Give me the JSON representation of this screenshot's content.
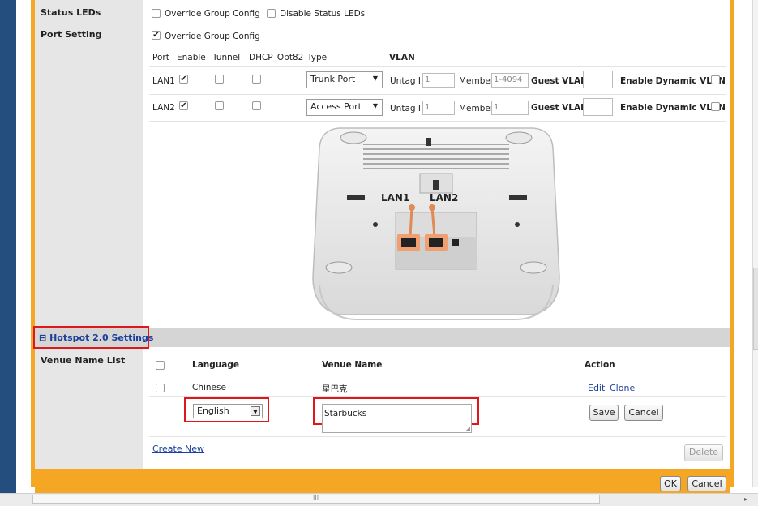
{
  "status_leds": {
    "label": "Status LEDs",
    "override_label": "Override Group Config",
    "override_checked": false,
    "disable_label": "Disable Status LEDs",
    "disable_checked": false
  },
  "port_setting": {
    "label": "Port Setting",
    "override_label": "Override Group Config",
    "override_checked": true,
    "headers": [
      "Port",
      "Enable",
      "Tunnel",
      "DHCP_Opt82",
      "Type",
      "VLAN"
    ],
    "rows": [
      {
        "port": "LAN1",
        "enable": true,
        "tunnel": false,
        "dhcp": false,
        "type": "Trunk Port",
        "untag_label": "Untag ID",
        "untag_value": "1",
        "members_label": "Members",
        "members_value": "1-4094",
        "guest_label": "Guest VLAN",
        "guest_value": "",
        "dyn_label": "Enable Dynamic VLAN",
        "dyn_checked": false
      },
      {
        "port": "LAN2",
        "enable": true,
        "tunnel": false,
        "dhcp": false,
        "type": "Access Port",
        "untag_label": "Untag ID",
        "untag_value": "1",
        "members_label": "Members",
        "members_value": "1",
        "guest_label": "Guest VLAN",
        "guest_value": "",
        "dyn_label": "Enable Dynamic VLAN",
        "dyn_checked": false
      }
    ],
    "image": {
      "lan1": "LAN1",
      "lan2": "LAN2"
    }
  },
  "hotspot": {
    "toggle": "⊟",
    "title": "Hotspot 2.0 Settings",
    "venue_label": "Venue Name List",
    "col_language": "Language",
    "col_venue": "Venue Name",
    "col_action": "Action",
    "row": {
      "language": "Chinese",
      "venue": "星巴克",
      "edit": "Edit",
      "clone": "Clone"
    },
    "edit_row": {
      "language": "English",
      "venue": "Starbucks",
      "save": "Save",
      "cancel": "Cancel"
    },
    "create_new": "Create New",
    "delete": "Delete"
  },
  "footer": {
    "ok": "OK",
    "cancel": "Cancel"
  },
  "scroll": {
    "grip": "III",
    "arrow": "▸"
  }
}
